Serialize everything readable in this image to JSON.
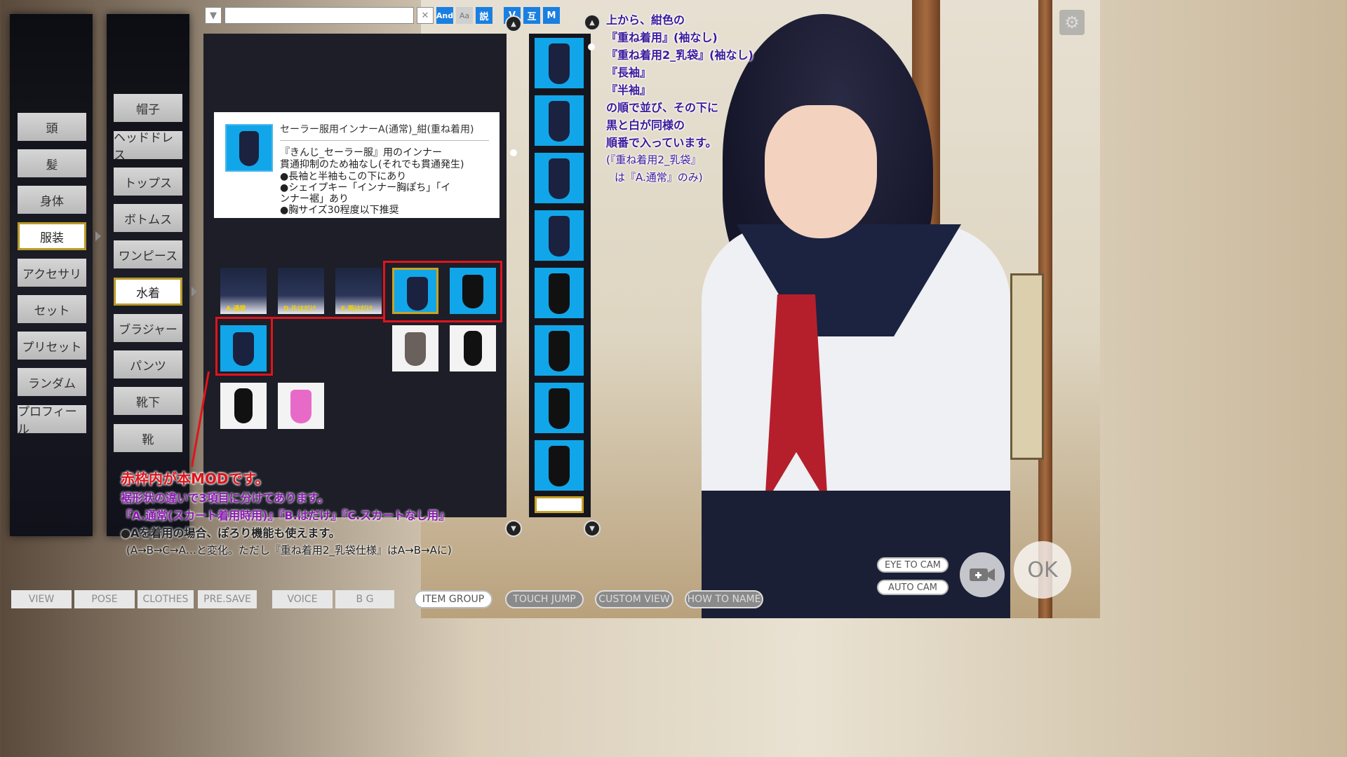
{
  "toolbar": {
    "dropdown_icon": "▼",
    "clear_icon": "✕",
    "and_label": "And",
    "aa_label": "Aa",
    "desc_label": "説",
    "v_label": "V",
    "swap_label": "互",
    "m_label": "M"
  },
  "categories": [
    "頭",
    "髪",
    "身体",
    "服装",
    "アクセサリ",
    "セット",
    "プリセット",
    "ランダム",
    "プロフィール"
  ],
  "subcategories": [
    "帽子",
    "ヘッドドレス",
    "トップス",
    "ボトムス",
    "ワンピース",
    "水着",
    "ブラジャー",
    "パンツ",
    "靴下",
    "靴"
  ],
  "description": {
    "title": "セーラー服用インナーA(通常)_紺(重ね着用)",
    "lines": [
      "『きんじ_セーラー服』用のインナー",
      "貫通抑制のため袖なし(それでも貫通発生)",
      "●長袖と半袖もこの下にあり",
      "●シェイプキー「インナー胸ぽち」「イ",
      "ンナー裾」あり",
      "●胸サイズ30程度以下推奨"
    ]
  },
  "items": {
    "sailor_labels": [
      "A.通常",
      "D.片はだけ",
      "E.両はだけ"
    ]
  },
  "note_top": [
    "上から、紺色の",
    "『重ね着用』(袖なし)",
    "『重ね着用2_乳袋』(袖なし)",
    "『長袖』",
    "『半袖』",
    "の順で並び、その下に",
    "黒と白が同様の",
    "順番で入っています。",
    "(『重ね着用2_乳袋』",
    "は『A.通常』のみ)"
  ],
  "note_bottom": {
    "line1": "赤枠内が本MODです。",
    "line2": "裾形状の違いで3項目に分けてあります。",
    "line3": "『A.通常(スカート着用時用)』『B.はだけ』『C.スカートなし用』",
    "line4": "●Aを着用の場合、ぽろり機能も使えます。",
    "line5": "(A→B→C→A…と変化。ただし『重ね着用2_乳袋仕様』はA→B→Aに)"
  },
  "bottom_bar": {
    "view": "VIEW",
    "pose": "POSE",
    "clothes": "CLOTHES",
    "presave": "PRE.SAVE",
    "voice": "VOICE",
    "bg": "B G",
    "item_group": "ITEM GROUP",
    "touch_jump": "TOUCH JUMP",
    "custom_view": "CUSTOM VIEW",
    "how_to_name": "HOW TO NAME"
  },
  "camera": {
    "eye_to_cam": "EYE TO CAM",
    "auto_cam": "AUTO CAM",
    "ok": "OK"
  },
  "icons": {
    "settings": "gear-icon",
    "camera_add": "camera-add-icon",
    "scroll_up": "chevron-up-icon",
    "scroll_down": "chevron-down-icon"
  },
  "colors": {
    "accent_blue": "#1a7fe0",
    "item_blue": "#11a6ea",
    "highlight_red": "#e0141c",
    "active_gold": "#b89a2a"
  }
}
